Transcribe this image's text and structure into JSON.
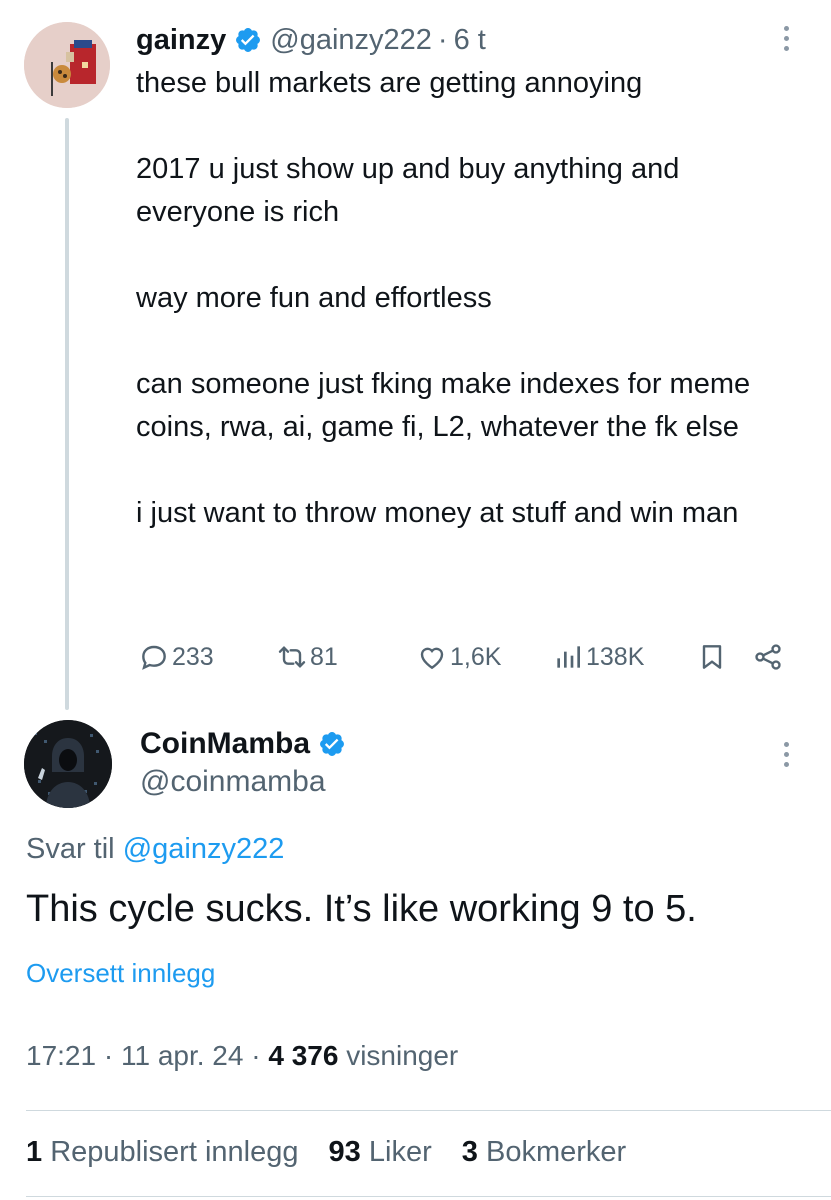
{
  "parent_tweet": {
    "display_name": "gainzy",
    "handle": "@gainzy222",
    "separator": "·",
    "time_ago": "6 t",
    "paragraphs": [
      "these bull markets are getting annoying",
      "2017 u just show up and buy anything and everyone is rich",
      "way more fun and effortless",
      "can someone just fking make indexes for meme coins, rwa, ai, game fi, L2, whatever the fk else",
      "i just want to throw money at stuff and win man"
    ],
    "actions": {
      "replies": "233",
      "reposts": "81",
      "likes": "1,6K",
      "views": "138K"
    }
  },
  "reply_tweet": {
    "display_name": "CoinMamba",
    "handle": "@coinmamba",
    "reply_prefix": "Svar til",
    "reply_to": "@gainzy222",
    "text": "This cycle sucks. It’s like working 9 to 5.",
    "translate_label": "Oversett innlegg",
    "time": "17:21",
    "separator": "·",
    "date": "11 apr. 24",
    "view_count": "4 376",
    "views_label": "visninger",
    "stats": {
      "reposts_count": "1",
      "reposts_label": "Republisert innlegg",
      "likes_count": "93",
      "likes_label": "Liker",
      "bookmarks_count": "3",
      "bookmarks_label": "Bokmerker"
    }
  },
  "colors": {
    "text": "#0f1419",
    "secondary": "#536471",
    "accent": "#1d9bf0",
    "divider": "#cfd9de"
  },
  "icons": [
    "verified-badge-icon",
    "more-icon",
    "reply-icon",
    "repost-icon",
    "like-icon",
    "views-icon",
    "bookmark-icon",
    "share-icon"
  ]
}
